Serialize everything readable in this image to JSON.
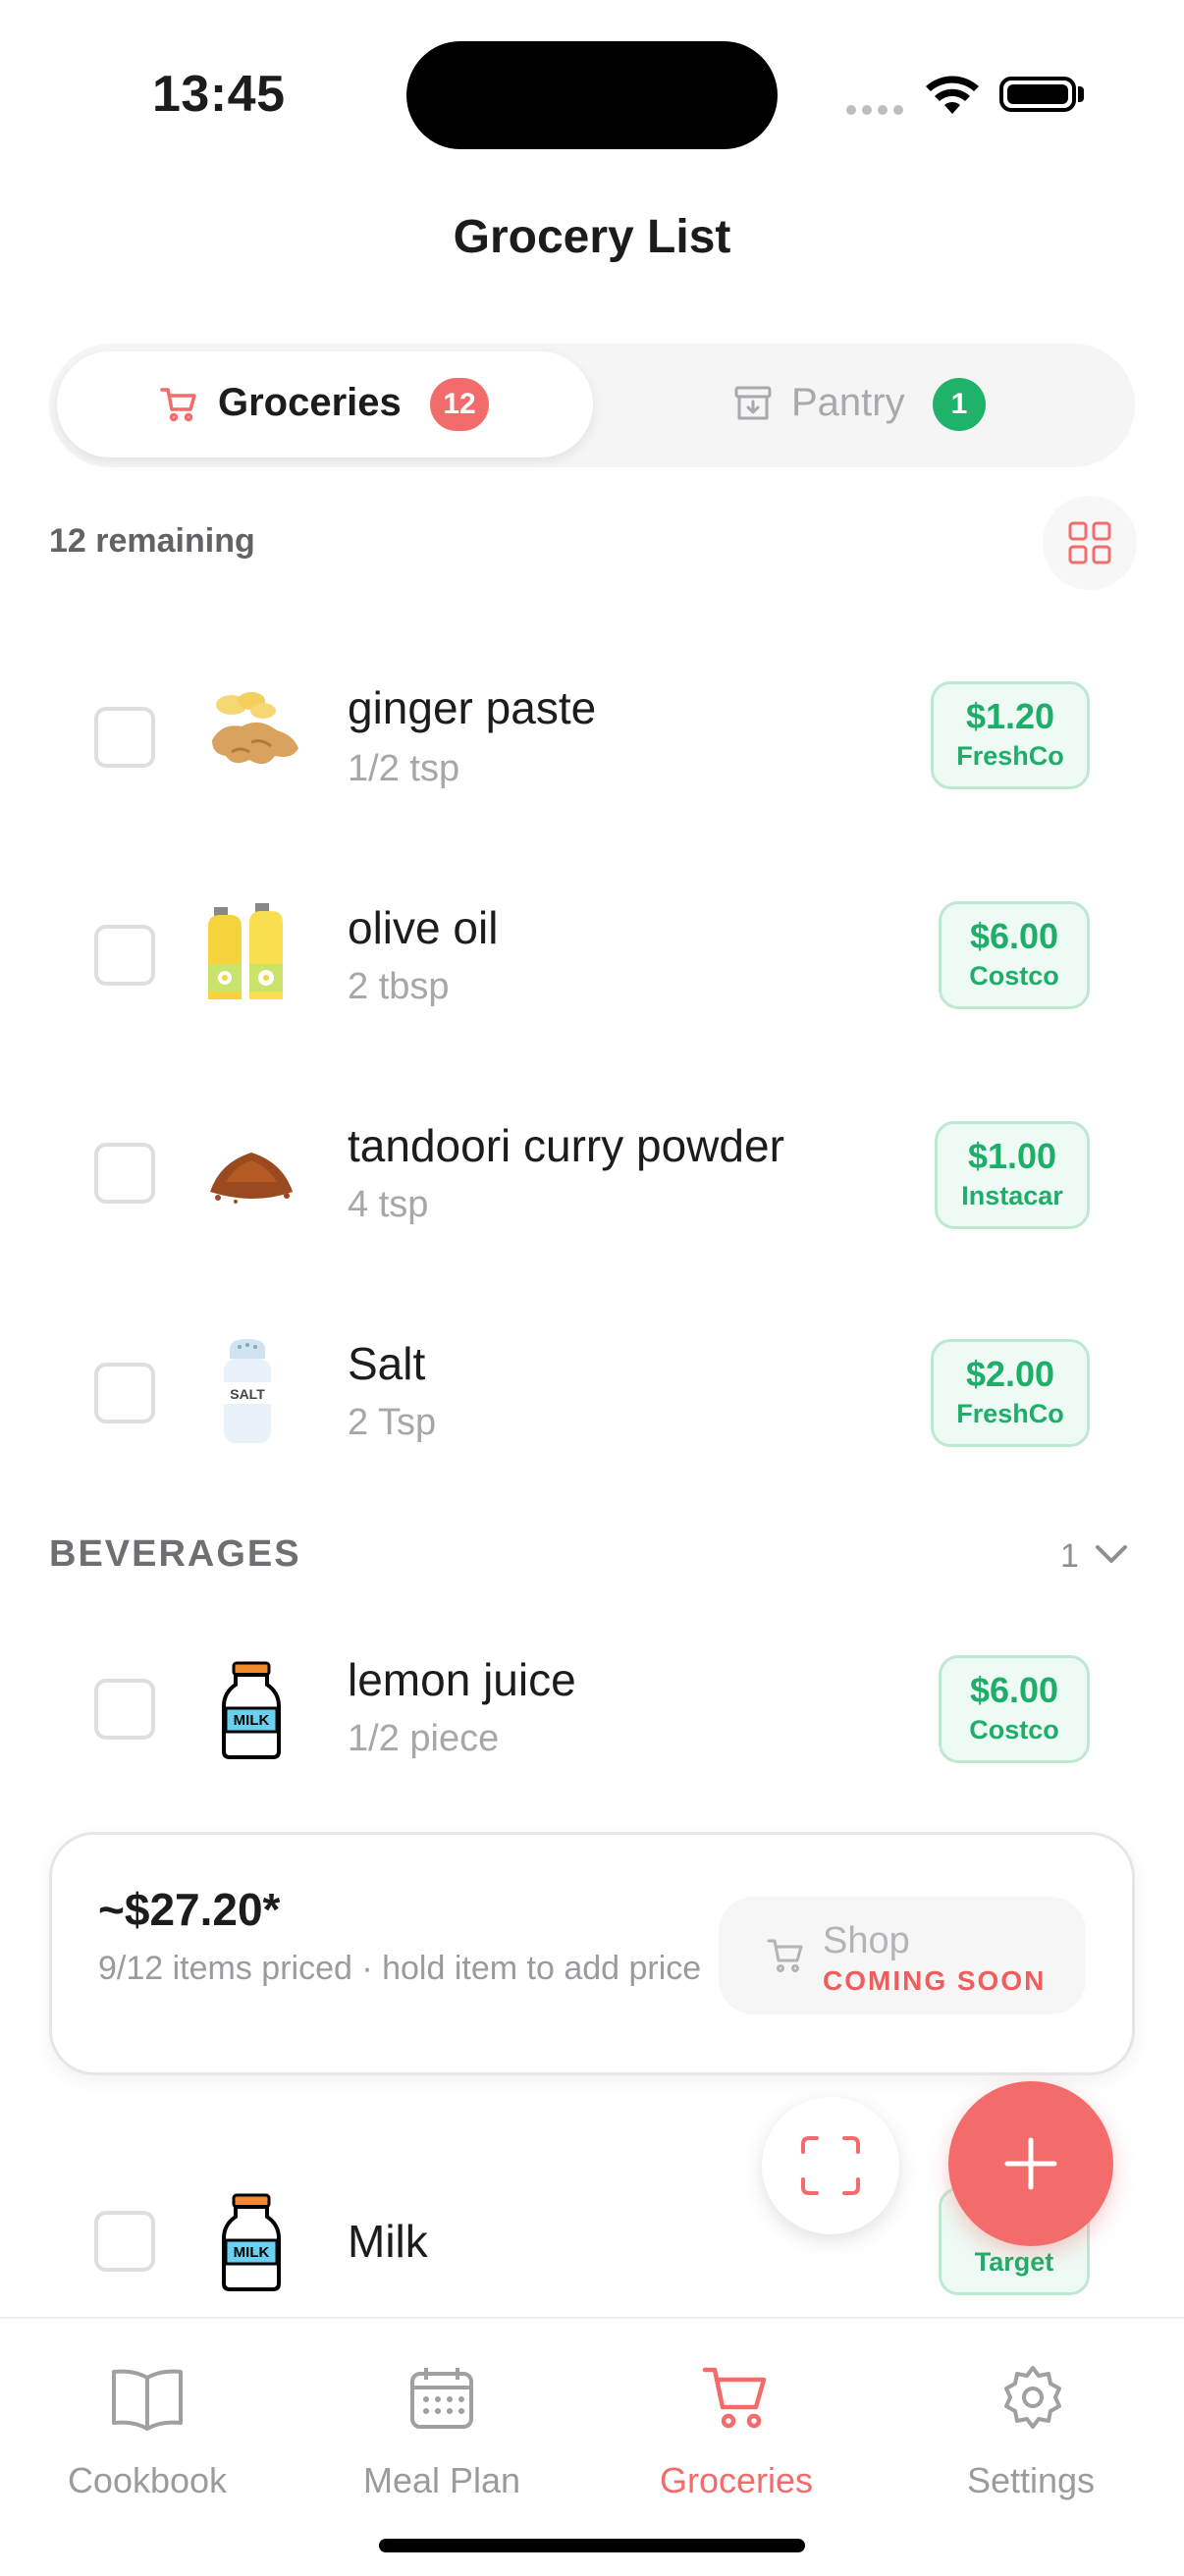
{
  "status_bar": {
    "time": "13:45"
  },
  "header": {
    "title": "Grocery List"
  },
  "segments": {
    "groceries": {
      "label": "Groceries",
      "count": "12"
    },
    "pantry": {
      "label": "Pantry",
      "count": "1"
    }
  },
  "list": {
    "remaining_text": "12 remaining",
    "items": [
      {
        "name": "ginger paste",
        "qty": "1/2 tsp",
        "price": "$1.20",
        "store": "FreshCo",
        "icon": "ginger-icon"
      },
      {
        "name": "olive oil",
        "qty": "2 tbsp",
        "price": "$6.00",
        "store": "Costco",
        "icon": "olive-oil-icon"
      },
      {
        "name": "tandoori curry powder",
        "qty": "4 tsp",
        "price": "$1.00",
        "store": "Instacar",
        "icon": "spice-powder-icon"
      },
      {
        "name": "Salt",
        "qty": "2 Tsp",
        "price": "$2.00",
        "store": "FreshCo",
        "icon": "salt-shaker-icon"
      }
    ],
    "sections": [
      {
        "title": "BEVERAGES",
        "count": "1",
        "items": [
          {
            "name": "lemon juice",
            "qty": "1/2 piece",
            "price": "$6.00",
            "store": "Costco",
            "icon": "milk-bottle-icon",
            "bottle_label": "MILK"
          }
        ]
      }
    ],
    "partial_item": {
      "name": "Milk",
      "price": "$",
      "store": "Target",
      "icon": "milk-bottle-icon",
      "bottle_label": "MILK"
    },
    "salt_label": "SALT"
  },
  "summary": {
    "total": "~$27.20*",
    "note": "9/12 items priced · hold item to add price",
    "shop_label": "Shop",
    "shop_sub": "COMING SOON"
  },
  "tabbar": {
    "tabs": [
      {
        "label": "Cookbook",
        "icon": "book-icon"
      },
      {
        "label": "Meal Plan",
        "icon": "calendar-icon"
      },
      {
        "label": "Groceries",
        "icon": "cart-icon",
        "active": true
      },
      {
        "label": "Settings",
        "icon": "gear-icon"
      }
    ]
  },
  "colors": {
    "accent": "#f46b6b",
    "price_green": "#1fad6a",
    "pantry_badge": "#1fb26b"
  }
}
